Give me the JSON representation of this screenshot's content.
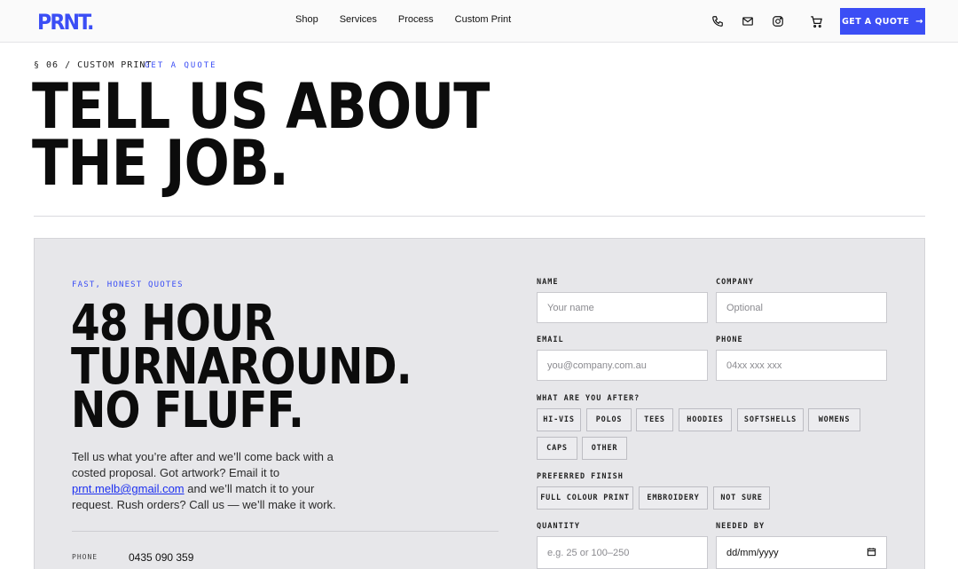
{
  "header": {
    "logo": "PRNT.",
    "nav": [
      "Shop",
      "Services",
      "Process",
      "Custom Print"
    ],
    "icons": [
      "phone-icon",
      "mail-icon",
      "instagram-icon",
      "cart-icon"
    ],
    "cta_label": "GET A QUOTE",
    "cta_arrow": "→"
  },
  "hero": {
    "eyebrow": "§ 06 / CUSTOM PRINT",
    "eyebrow_link": "GET A QUOTE",
    "title_line1": "TELL US ABOUT",
    "title_line2": "THE JOB."
  },
  "panel": {
    "kicker": "FAST, HONEST QUOTES",
    "big_line1": "48 HOUR",
    "big_line2": "TURNAROUND.",
    "big_line3": "NO FLUFF.",
    "intro_before": "Tell us what you’re after and we’ll come back with a costed proposal. Got artwork? Email it to ",
    "email": "prnt.melb@gmail.com",
    "intro_after": " and we’ll match it to your request. Rush orders? Call us — we’ll make it work.",
    "phone_label": "PHONE",
    "phone_value": "0435 090 359"
  },
  "form": {
    "name_label": "NAME",
    "name_placeholder": "Your name",
    "company_label": "COMPANY",
    "company_placeholder": "Optional",
    "email_label": "EMAIL",
    "email_placeholder": "you@company.com.au",
    "phone_label": "PHONE",
    "phone_placeholder": "04xx xxx xxx",
    "after_label": "WHAT ARE YOU AFTER?",
    "products": [
      "HI-VIS",
      "POLOS",
      "TEES",
      "HOODIES",
      "SOFTSHELLS",
      "WOMENS",
      "CAPS",
      "OTHER"
    ],
    "finish_label": "PREFERRED FINISH",
    "finishes": [
      "FULL COLOUR PRINT",
      "EMBROIDERY",
      "NOT SURE"
    ],
    "quantity_label": "QUANTITY",
    "quantity_placeholder": "e.g. 25 or 100–250",
    "needed_label": "NEEDED BY",
    "needed_value": "dd/mm/yyyy"
  },
  "colors": {
    "accent": "#3b4ef5",
    "panel_bg": "#e7e7ea"
  }
}
